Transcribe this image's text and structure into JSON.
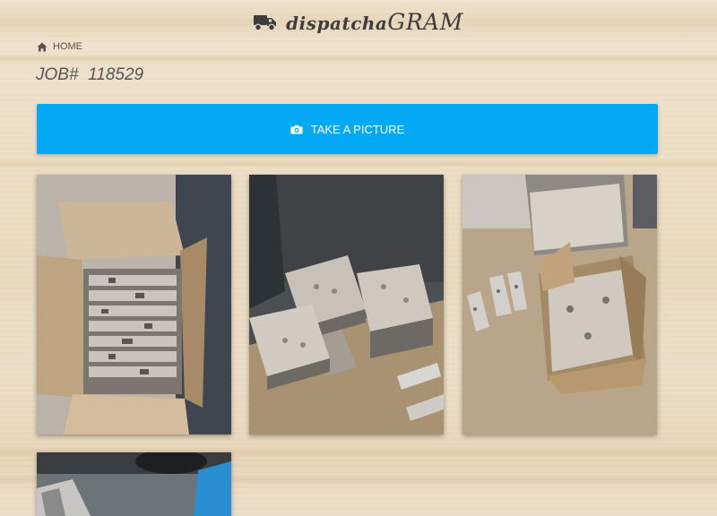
{
  "brand": {
    "lower": "dispatcha",
    "upper": "GRAM",
    "icon": "truck-icon"
  },
  "breadcrumb": {
    "icon": "home-icon",
    "label": "HOME"
  },
  "job": {
    "prefix": "JOB#",
    "number": "118529"
  },
  "take_picture": {
    "icon": "camera-icon",
    "label": "TAKE A PICTURE",
    "color": "#04a9f5"
  },
  "photos": [
    {
      "subject": "open cardboard box packed with metal parts"
    },
    {
      "subject": "stacks of metal plates on a warehouse floor"
    },
    {
      "subject": "metal plates and a filled cardboard box"
    },
    {
      "subject": "partially visible photo"
    }
  ]
}
